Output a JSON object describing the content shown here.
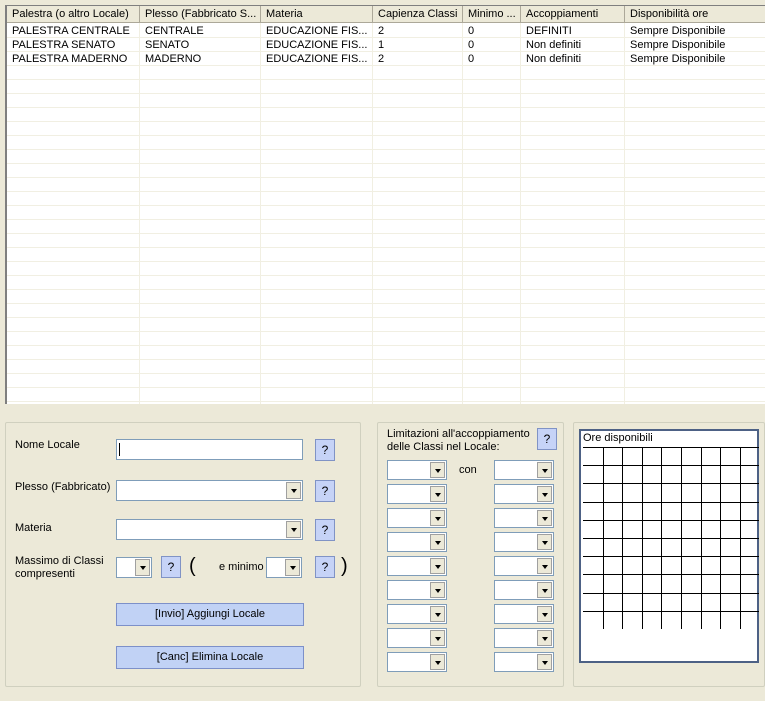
{
  "table": {
    "columns": [
      "Palestra (o altro Locale)",
      "Plesso (Fabbricato S...",
      "Materia",
      "Capienza Classi",
      "Minimo ...",
      "Accoppiamenti",
      "Disponibilità ore"
    ],
    "rows": [
      [
        "PALESTRA CENTRALE",
        "CENTRALE",
        "EDUCAZIONE FIS...",
        "2",
        "0",
        "DEFINITI",
        "Sempre Disponibile"
      ],
      [
        "PALESTRA SENATO",
        "SENATO",
        "EDUCAZIONE FIS...",
        "1",
        "0",
        "Non definiti",
        "Sempre Disponibile"
      ],
      [
        "PALESTRA MADERNO",
        "MADERNO",
        "EDUCAZIONE FIS...",
        "2",
        "0",
        "Non definiti",
        "Sempre Disponibile"
      ]
    ]
  },
  "form": {
    "nome_label": "Nome Locale",
    "nome_value": "",
    "plesso_label": "Plesso (Fabbricato)",
    "plesso_value": "",
    "materia_label": "Materia",
    "materia_value": "",
    "massimo_label_1": "Massimo di Classi",
    "massimo_label_2": "compresenti",
    "massimo_value": "",
    "minimo_label": "e minimo",
    "minimo_value": "",
    "paren_open": "(",
    "paren_close": ")",
    "help_label": "?",
    "add_button": "[Invio] Aggiungi Locale",
    "delete_button": "[Canc] Elimina Locale"
  },
  "limits": {
    "title_1": "Limitazioni all'accoppiamento",
    "title_2": "delle Classi nel Locale:",
    "con_label": "con",
    "pair_count": 9
  },
  "hours": {
    "title": "Ore disponibili",
    "cols": 9,
    "rows": 10
  }
}
